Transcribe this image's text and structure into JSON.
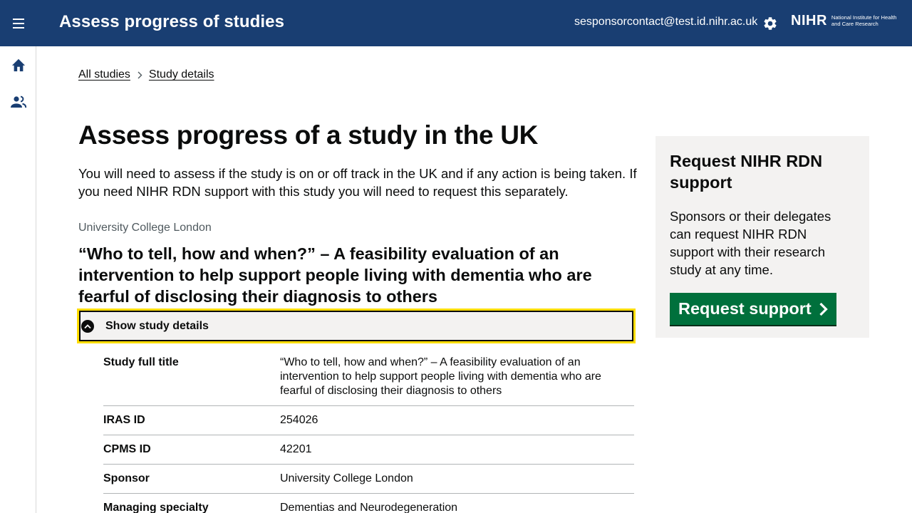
{
  "header": {
    "app_title": "Assess progress of studies",
    "user_email": "sesponsorcontact@test.id.nihr.ac.uk",
    "logo_mark": "NIHR",
    "logo_sub": "National Institute for Health and Care Research",
    "menu_icon": "menu-icon",
    "settings_icon": "gear-icon",
    "background_color": "#193e72"
  },
  "sidebar": {
    "items": [
      {
        "name": "home",
        "icon": "home-icon"
      },
      {
        "name": "users",
        "icon": "people-icon"
      }
    ]
  },
  "breadcrumb": {
    "items": [
      {
        "label": "All studies"
      },
      {
        "label": "Study details"
      }
    ]
  },
  "main": {
    "title": "Assess progress of a study in the UK",
    "intro": "You will need to assess if the study is on or off track in the UK and if any action is being taken. If you need NIHR RDN support with this study you will need to request this separately.",
    "org_caption": "University College London",
    "study_heading": "“Who to tell, how and when?” – A feasibility evaluation of an intervention to help support people living with dementia who are fearful of disclosing their diagnosis to others",
    "details_toggle": {
      "label": "Show study details",
      "icon": "chevron-up-circle-icon"
    },
    "summary": [
      {
        "key": "Study full title",
        "value": "“Who to tell, how and when?” – A feasibility evaluation of an intervention to help support people living with dementia who are fearful of disclosing their diagnosis to others"
      },
      {
        "key": "IRAS ID",
        "value": "254026"
      },
      {
        "key": "CPMS ID",
        "value": "42201"
      },
      {
        "key": "Sponsor",
        "value": "University College London"
      },
      {
        "key": "Managing specialty",
        "value": "Dementias and Neurodegeneration"
      }
    ]
  },
  "aside": {
    "title": "Request NIHR RDN support",
    "text": "Sponsors or their delegates can request NIHR RDN support with their research study at any time.",
    "button_label": "Request support",
    "button_color": "#00703c"
  }
}
